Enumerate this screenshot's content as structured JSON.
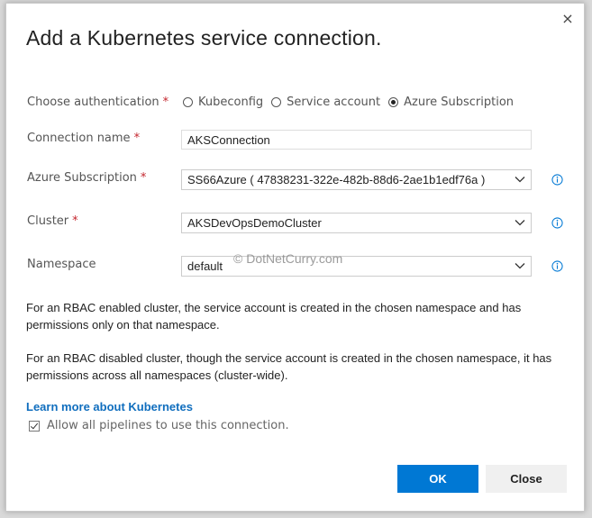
{
  "dialog": {
    "title": "Add a Kubernetes service connection.",
    "close_symbol": "×"
  },
  "auth": {
    "label": "Choose authentication",
    "required": "*",
    "options": [
      "Kubeconfig",
      "Service account",
      "Azure Subscription"
    ],
    "selected": "Azure Subscription"
  },
  "connection_name": {
    "label": "Connection name",
    "required": "*",
    "value": "AKSConnection"
  },
  "subscription": {
    "label": "Azure Subscription",
    "required": "*",
    "value": "SS66Azure ( 47838231-322e-482b-88d6-2ae1b1edf76a )"
  },
  "cluster": {
    "label": "Cluster",
    "required": "*",
    "value": "AKSDevOpsDemoCluster"
  },
  "namespace": {
    "label": "Namespace",
    "value": "default"
  },
  "watermark": "© DotNetCurry.com",
  "info": {
    "rbac_enabled": "For an RBAC enabled cluster, the service account is created in the chosen namespace and has permissions only on that namespace.",
    "rbac_disabled": "For an RBAC disabled cluster, though the service account is created in the chosen namespace, it has permissions across all namespaces (cluster-wide)."
  },
  "learn_more": "Learn more about Kubernetes",
  "allow_pipelines": {
    "label": "Allow all pipelines to use this connection.",
    "checked": true
  },
  "buttons": {
    "ok": "OK",
    "close": "Close"
  },
  "colors": {
    "accent": "#0078d4",
    "link": "#106ebe",
    "required": "#c4262e"
  }
}
